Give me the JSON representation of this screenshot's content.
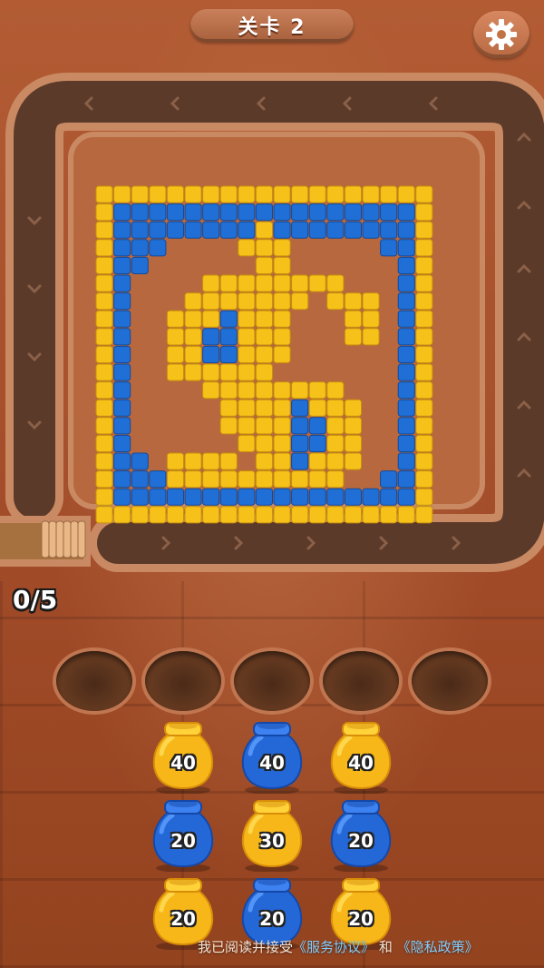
{
  "header": {
    "level_label": "关卡 2"
  },
  "counter": {
    "text": "0/5"
  },
  "colors": {
    "yellow": "#f6c21a",
    "blue": "#1f6fd6",
    "track": "#5b3a2a",
    "rim": "#c98a63"
  },
  "icons": {
    "settings": "gear-icon"
  },
  "board": {
    "rows": [
      "YYYYYYYYYYYYYYYYYYY",
      "YBBBBBBBBBBBBBBBBBY",
      "YBBBBBBBBYBBBBBBBBY",
      "YBBB....YYY.....BBY",
      "YBB......YY......BY",
      "YB....YYYYYYYY...BY",
      "YB...YYYYYYY.YYY.BY",
      "YB..YYYBYYY...YY.BY",
      "YB..YYBBYYY...YY.BY",
      "YB..YYBBYYY......BY",
      "YB..YYYYYY.......BY",
      "YB....YYYYYYYY...BY",
      "YB.....YYYYBYYY..BY",
      "YB.....YYYYBBYY..BY",
      "YB......YYYBBYY..BY",
      "YBB.YYYY.YYBYYY..BY",
      "YBBBYYYYYYYYYY..BBY",
      "YBBBBBBBBBBBBBBBBBY",
      "YYYYYYYYYYYYYYYYYYY"
    ]
  },
  "slots": {
    "count": 5
  },
  "pots": [
    {
      "color": "yellow",
      "value": "40"
    },
    {
      "color": "blue",
      "value": "40"
    },
    {
      "color": "yellow",
      "value": "40"
    },
    {
      "color": "blue",
      "value": "20"
    },
    {
      "color": "yellow",
      "value": "30"
    },
    {
      "color": "blue",
      "value": "20"
    },
    {
      "color": "yellow",
      "value": "20"
    },
    {
      "color": "blue",
      "value": "20"
    },
    {
      "color": "yellow",
      "value": "20"
    }
  ],
  "footer": {
    "prefix": "我已阅读并接受",
    "service_link": "《服务协议》",
    "and": "和",
    "privacy_link": "《隐私政策》"
  }
}
